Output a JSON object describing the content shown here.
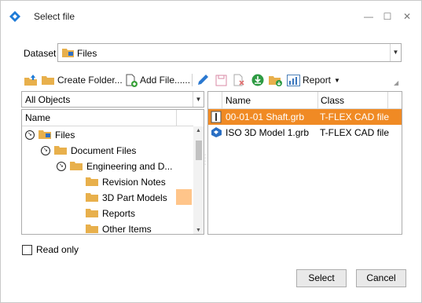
{
  "window": {
    "title": "Select file",
    "controls": {
      "minimize": "—",
      "maximize": "☐",
      "close": "✕"
    }
  },
  "dataset": {
    "label": "Dataset",
    "value": "Files"
  },
  "toolbar": {
    "items": [
      {
        "icon": "folder-up-icon"
      },
      {
        "icon": "folder-icon",
        "label": "Create Folder..."
      },
      {
        "icon": "add-file-icon",
        "label": "Add File......"
      },
      {
        "icon": "pencil-icon"
      },
      {
        "icon": "save-icon"
      },
      {
        "icon": "delete-file-icon"
      },
      {
        "icon": "download-icon"
      },
      {
        "icon": "folder-download-icon"
      },
      {
        "icon": "report-icon",
        "label": "Report"
      }
    ]
  },
  "tree": {
    "filter": "All Objects",
    "column": "Name",
    "nodes": [
      {
        "label": "Files",
        "level": 0,
        "expanded": true
      },
      {
        "label": "Document Files",
        "level": 1,
        "expanded": true
      },
      {
        "label": "Engineering and D...",
        "level": 2,
        "expanded": true
      },
      {
        "label": "Revision Notes",
        "level": 3
      },
      {
        "label": "3D Part Models",
        "level": 3,
        "selected": true
      },
      {
        "label": "Reports",
        "level": 3
      },
      {
        "label": "Other Items",
        "level": 3
      }
    ]
  },
  "files": {
    "columns": [
      "Name",
      "Class"
    ],
    "rows": [
      {
        "name": "00-01-01 Shaft.grb",
        "class": "T-FLEX CAD file",
        "selected": true
      },
      {
        "name": "ISO 3D Model 1.grb",
        "class": "T-FLEX CAD file",
        "selected": false
      }
    ]
  },
  "options": {
    "read_only_label": "Read only",
    "read_only_checked": false
  },
  "buttons": {
    "select": "Select",
    "cancel": "Cancel"
  },
  "colors": {
    "selection": "#f08a24",
    "tree_selection": "#ffc58a",
    "accent": "#1e7bd7",
    "folder": "#e8b04c"
  }
}
